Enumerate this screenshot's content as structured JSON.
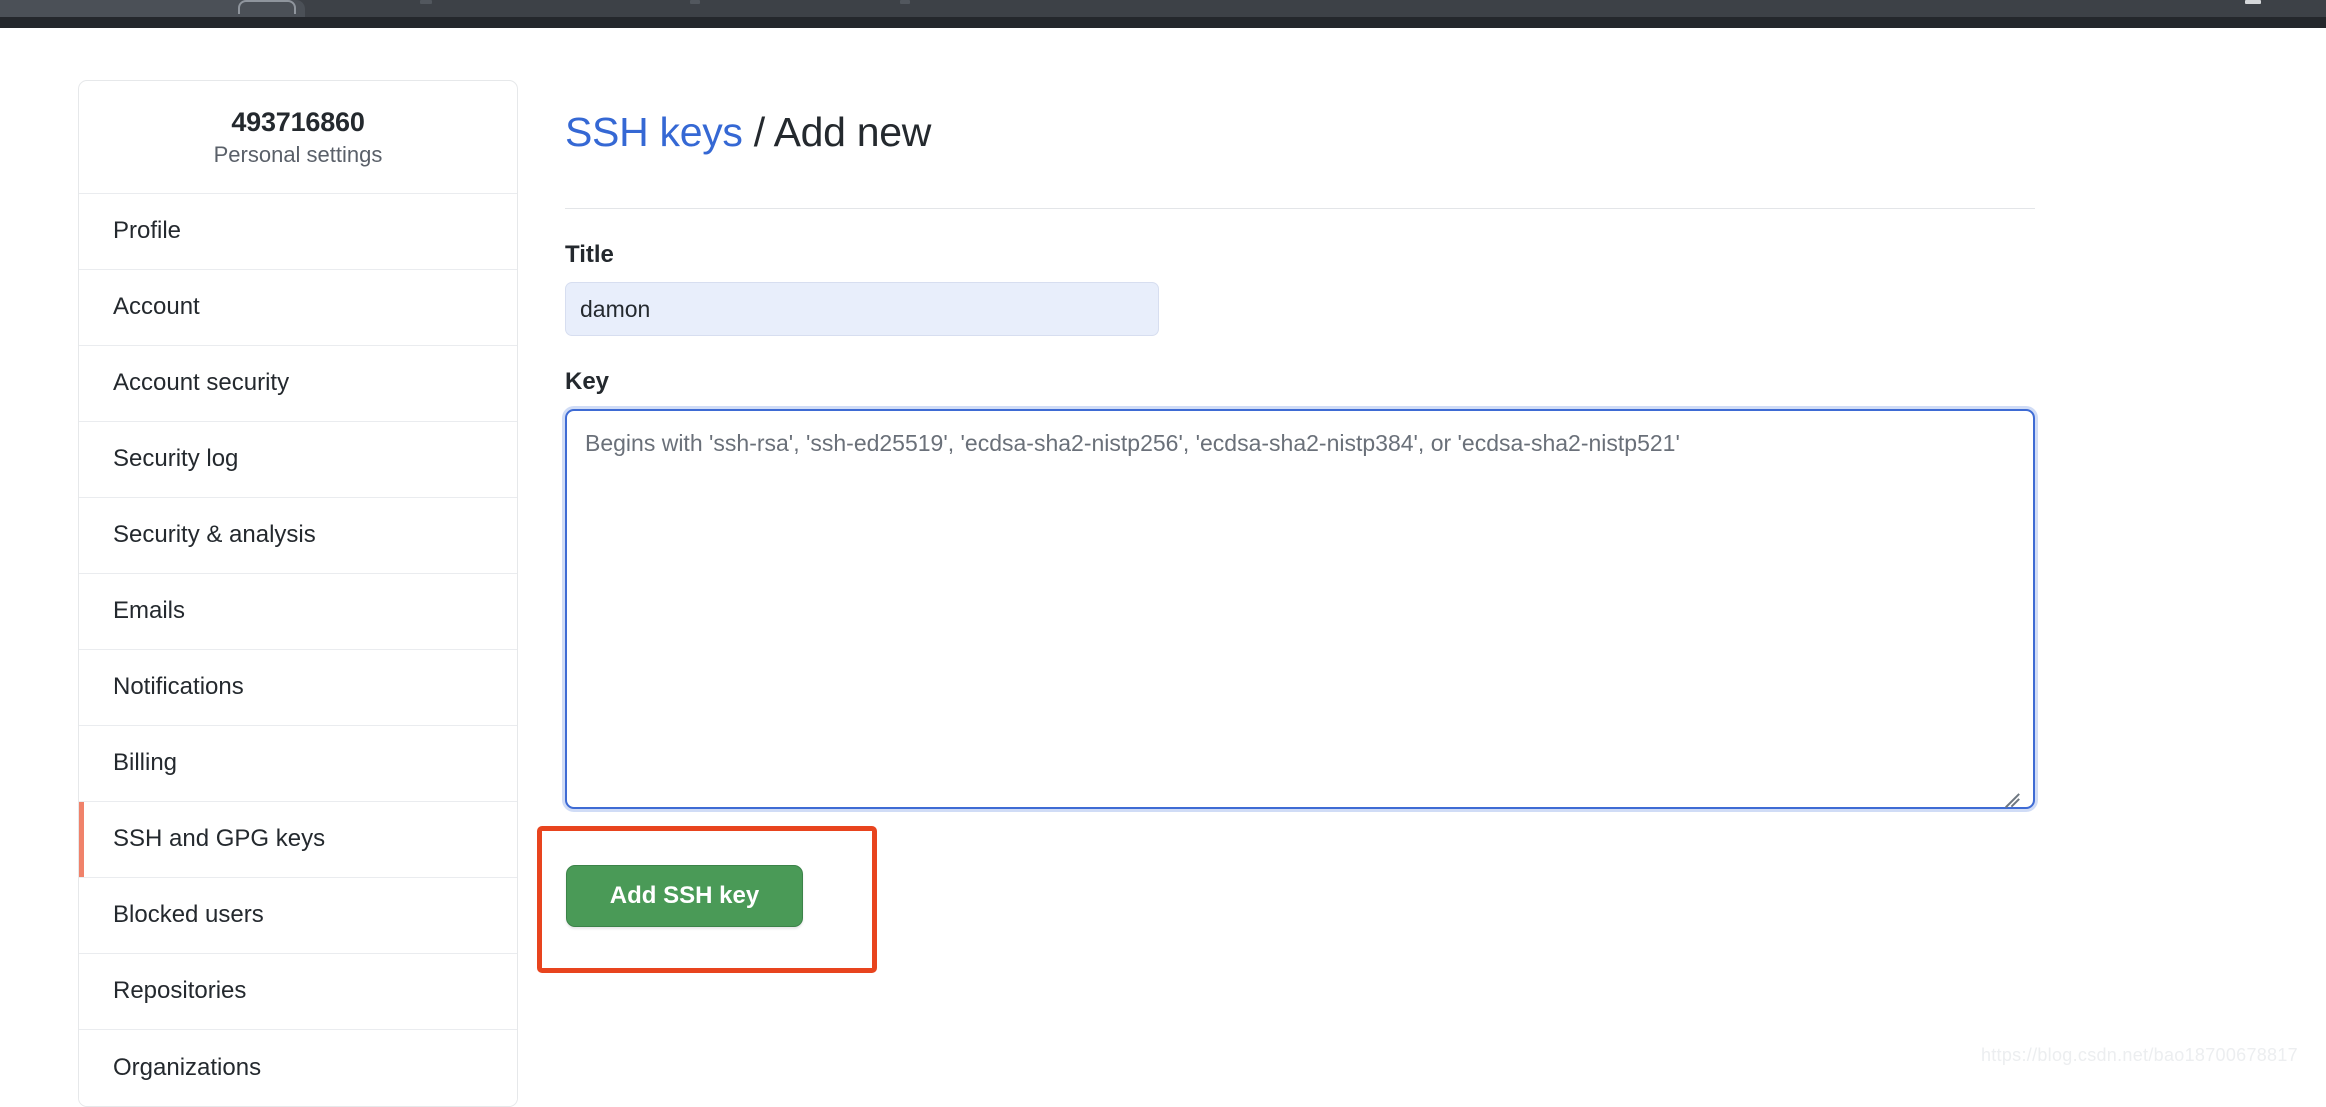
{
  "browser": {
    "tab_label": ""
  },
  "sidebar": {
    "username": "493716860",
    "subtitle": "Personal settings",
    "items": [
      {
        "label": "Profile",
        "active": false
      },
      {
        "label": "Account",
        "active": false
      },
      {
        "label": "Account security",
        "active": false
      },
      {
        "label": "Security log",
        "active": false
      },
      {
        "label": "Security & analysis",
        "active": false
      },
      {
        "label": "Emails",
        "active": false
      },
      {
        "label": "Notifications",
        "active": false
      },
      {
        "label": "Billing",
        "active": false
      },
      {
        "label": "SSH and GPG keys",
        "active": true
      },
      {
        "label": "Blocked users",
        "active": false
      },
      {
        "label": "Repositories",
        "active": false
      },
      {
        "label": "Organizations",
        "active": false
      }
    ],
    "active_accent_color": "#f0826a"
  },
  "heading": {
    "link_text": "SSH keys",
    "separator": " / ",
    "current": "Add new",
    "link_color": "#3568d4"
  },
  "form": {
    "title_label": "Title",
    "title_value": "damon",
    "title_placeholder": "",
    "key_label": "Key",
    "key_value": "",
    "key_placeholder": "Begins with 'ssh-rsa', 'ssh-ed25519', 'ecdsa-sha2-nistp256', 'ecdsa-sha2-nistp384', or 'ecdsa-sha2-nistp521'",
    "submit_label": "Add SSH key",
    "submit_color": "#4a9a57",
    "focus_border_color": "#3e6bd4",
    "autofill_background": "#e8eefb"
  },
  "annotation": {
    "color": "#e8441e"
  },
  "watermark": {
    "text": "https://blog.csdn.net/bao18700678817"
  }
}
